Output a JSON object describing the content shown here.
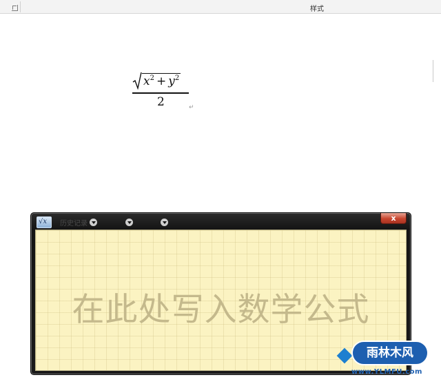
{
  "ribbon": {
    "group_label": "样式"
  },
  "formula": {
    "radicand_a": "x",
    "exponent_a": "2",
    "operator": "+",
    "radicand_b": "y",
    "exponent_b": "2",
    "denominator": "2",
    "paragraph_mark": "↵"
  },
  "math_input_panel": {
    "menu": [
      {
        "label": "历史记录"
      },
      {
        "label": ""
      },
      {
        "label": ""
      }
    ],
    "close_label": "x",
    "hint": "在此处写入数学公式"
  },
  "watermark": {
    "badge_text": "雨林木风",
    "url": "www.YLMFU.com"
  }
}
